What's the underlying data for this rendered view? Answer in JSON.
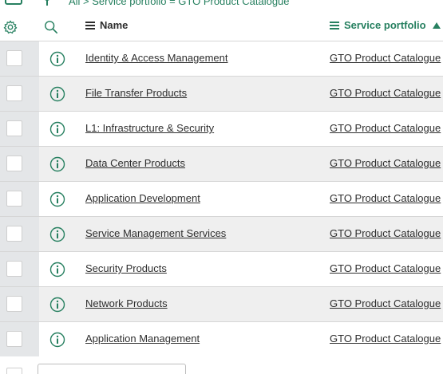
{
  "breadcrumb": "All > Service portfolio = GTO Product Catalogue",
  "columns": {
    "name": "Name",
    "portfolio": "Service portfolio"
  },
  "colors": {
    "accent": "#278060",
    "row_alt": "#efefef",
    "check_column": "#e4e6e8"
  },
  "rows": [
    {
      "name": "Identity & Access Management",
      "portfolio": "GTO Product Catalogue"
    },
    {
      "name": "File Transfer Products",
      "portfolio": "GTO Product Catalogue"
    },
    {
      "name": "L1: Infrastructure & Security",
      "portfolio": "GTO Product Catalogue"
    },
    {
      "name": "Data Center Products",
      "portfolio": "GTO Product Catalogue"
    },
    {
      "name": "Application Development",
      "portfolio": "GTO Product Catalogue"
    },
    {
      "name": "Service Management Services",
      "portfolio": "GTO Product Catalogue"
    },
    {
      "name": "Security Products",
      "portfolio": "GTO Product Catalogue"
    },
    {
      "name": "Network Products",
      "portfolio": "GTO Product Catalogue"
    },
    {
      "name": "Application Management",
      "portfolio": "GTO Product Catalogue"
    }
  ]
}
